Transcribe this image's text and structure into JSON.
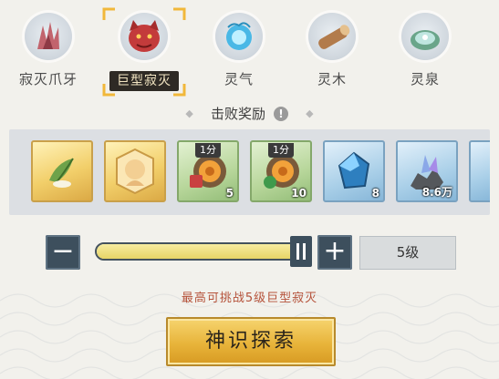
{
  "tabs": [
    {
      "label": "寂灭爪牙",
      "icon": "claw-icon",
      "selected": false
    },
    {
      "label": "巨型寂灭",
      "icon": "giant-beast-icon",
      "selected": true
    },
    {
      "label": "灵气",
      "icon": "spirit-energy-icon",
      "selected": false
    },
    {
      "label": "灵木",
      "icon": "spirit-wood-icon",
      "selected": false
    },
    {
      "label": "灵泉",
      "icon": "spirit-spring-icon",
      "selected": false
    }
  ],
  "rewards": {
    "title": "击败奖励",
    "info_icon": "!",
    "items": [
      {
        "name": "reward-leaf-fish",
        "icon": "leaf-fish-icon",
        "rarity": "gold",
        "badge": "",
        "qty": ""
      },
      {
        "name": "reward-portrait-token",
        "icon": "portrait-token-icon",
        "rarity": "gold",
        "badge": "",
        "qty": ""
      },
      {
        "name": "reward-red-coin",
        "icon": "red-coin-icon",
        "rarity": "green",
        "badge": "1分",
        "qty": "5"
      },
      {
        "name": "reward-green-coin",
        "icon": "green-coin-icon",
        "rarity": "green",
        "badge": "1分",
        "qty": "10"
      },
      {
        "name": "reward-blue-crystal",
        "icon": "blue-crystal-icon",
        "rarity": "blue",
        "badge": "",
        "qty": "8"
      },
      {
        "name": "reward-ore",
        "icon": "ore-icon",
        "rarity": "blue",
        "badge": "",
        "qty": "8.6万"
      }
    ]
  },
  "level_control": {
    "minus": "−",
    "plus": "+",
    "value": "5级",
    "slider_fill": 0.92
  },
  "hint": "最高可挑战5级巨型寂灭",
  "explore_button": "神识探索",
  "colors": {
    "accent_gold": "#e8b43a",
    "hint_red": "#b5523a",
    "dark_btn": "#3d4f5d"
  }
}
